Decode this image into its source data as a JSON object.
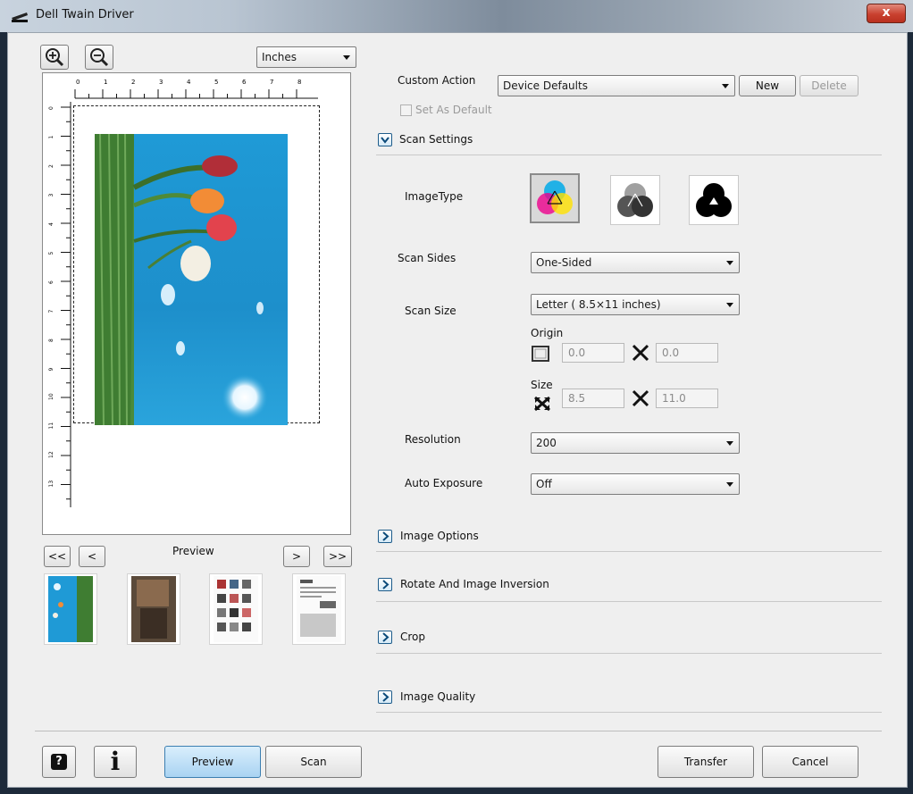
{
  "window": {
    "title": "Dell Twain Driver",
    "close_label": "x"
  },
  "toolbar": {
    "zoom_in_icon": "zoom-in-icon",
    "zoom_out_icon": "zoom-out-icon",
    "units": "Inches"
  },
  "ruler": {
    "horizontal_ticks": [
      "0",
      "1",
      "2",
      "3",
      "4",
      "5",
      "6",
      "7",
      "8"
    ],
    "vertical_ticks": [
      "0",
      "1",
      "2",
      "3",
      "4",
      "5",
      "6",
      "7",
      "8",
      "9",
      "10",
      "11",
      "12",
      "13"
    ]
  },
  "preview_nav": {
    "first_label": "<<",
    "prev_label": "<",
    "title": "Preview",
    "next_label": ">",
    "last_label": ">>"
  },
  "custom_action": {
    "label": "Custom Action",
    "value": "Device Defaults",
    "new_label": "New",
    "delete_label": "Delete",
    "set_default_label": "Set As Default"
  },
  "scan_settings": {
    "header": "Scan Settings",
    "image_type_label": "ImageType",
    "image_types": [
      "color",
      "grayscale",
      "black-and-white"
    ],
    "scan_sides_label": "Scan Sides",
    "scan_sides_value": "One-Sided",
    "scan_size_label": "Scan Size",
    "scan_size_value": "Letter ( 8.5×11 inches)",
    "origin_label": "Origin",
    "origin_x": "0.0",
    "origin_y": "0.0",
    "size_label": "Size",
    "size_w": "8.5",
    "size_h": "11.0",
    "resolution_label": "Resolution",
    "resolution_value": "200",
    "auto_exposure_label": "Auto Exposure",
    "auto_exposure_value": "Off"
  },
  "sections": {
    "image_options": "Image Options",
    "rotate": "Rotate And Image Inversion",
    "crop": "Crop",
    "image_quality": "Image Quality"
  },
  "footer": {
    "help_icon": "help-icon",
    "info_icon": "info-icon",
    "info_glyph": "i",
    "help_glyph": "?",
    "preview_label": "Preview",
    "scan_label": "Scan",
    "transfer_label": "Transfer",
    "cancel_label": "Cancel"
  },
  "colors": {
    "accent": "#1e5c8a",
    "preview_button": "#bcdcf5",
    "sky": "#1f9ad6"
  }
}
